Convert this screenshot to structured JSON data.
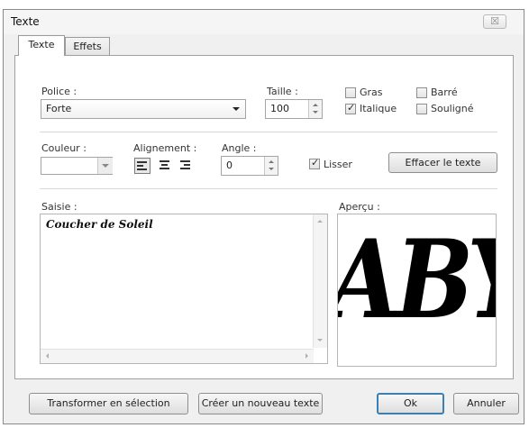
{
  "window": {
    "title": "Texte",
    "close_glyph": "☒"
  },
  "tabs": [
    {
      "label": "Texte"
    },
    {
      "label": "Effets"
    }
  ],
  "font": {
    "police_label": "Police :",
    "police_value": "Forte",
    "taille_label": "Taille :",
    "taille_value": "100"
  },
  "styles": {
    "gras": {
      "label": "Gras",
      "checked": false
    },
    "italique": {
      "label": "Italique",
      "checked": true
    },
    "barre": {
      "label": "Barré",
      "checked": false
    },
    "souligne": {
      "label": "Souligné",
      "checked": false
    }
  },
  "couleur_label": "Couleur :",
  "alignement_label": "Alignement :",
  "alignments": [
    "align-left-icon",
    "align-center-icon",
    "align-right-icon"
  ],
  "angle": {
    "label": "Angle :",
    "value": "0"
  },
  "lisser": {
    "label": "Lisser",
    "checked": true
  },
  "effacer_button": "Effacer le texte",
  "saisie": {
    "label": "Saisie :",
    "text": "Coucher de Soleil"
  },
  "apercu": {
    "label": "Aperçu :",
    "preview_text": "ABY"
  },
  "footer": {
    "transformer": "Transformer en sélection",
    "creer": "Créer un nouveau texte",
    "ok": "Ok",
    "annuler": "Annuler"
  },
  "colors": {
    "window_bg": "#f0f0f0",
    "panel_bg": "#ffffff",
    "ok_border": "#3c7fb1"
  }
}
